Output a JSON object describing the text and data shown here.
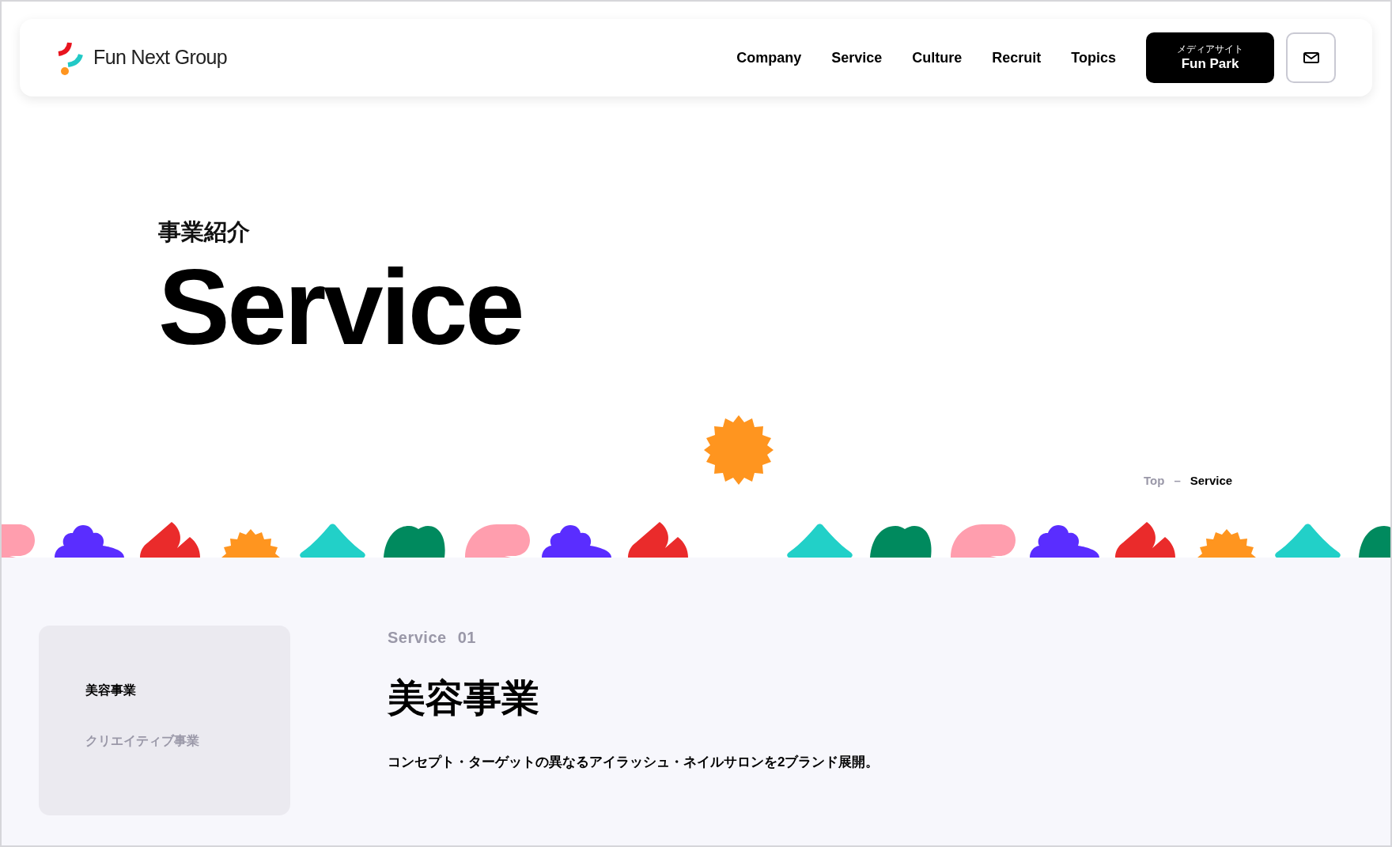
{
  "header": {
    "logo_text": "Fun Next Group",
    "nav": [
      {
        "label": "Company"
      },
      {
        "label": "Service"
      },
      {
        "label": "Culture"
      },
      {
        "label": "Recruit"
      },
      {
        "label": "Topics"
      }
    ],
    "media_button": {
      "caption": "メディアサイト",
      "label": "Fun Park"
    }
  },
  "hero": {
    "subtitle": "事業紹介",
    "title": "Service"
  },
  "breadcrumb": {
    "separator": "–",
    "items": [
      {
        "label": "Top",
        "current": false
      },
      {
        "label": "Service",
        "current": true
      }
    ]
  },
  "sidebar": {
    "items": [
      {
        "label": "美容事業",
        "selected": true
      },
      {
        "label": "クリエイティブ事業",
        "selected": false
      }
    ]
  },
  "section": {
    "eyebrow": "Service",
    "number": "01",
    "title": "美容事業",
    "description": "コンセプト・ターゲットの異なるアイラッシュ・ネイルサロンを2ブランド展開。"
  }
}
